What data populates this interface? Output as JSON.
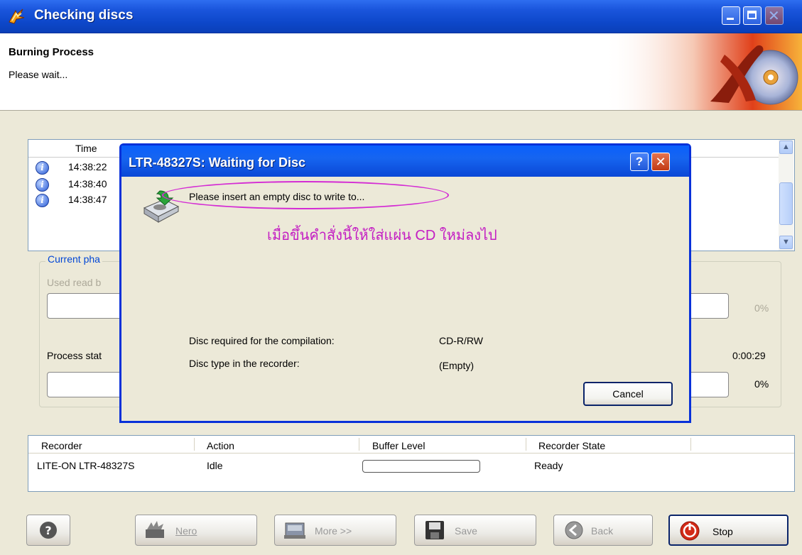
{
  "window": {
    "title": "Checking discs"
  },
  "header": {
    "title": "Burning Process",
    "subtitle": "Please wait..."
  },
  "log": {
    "column_time": "Time",
    "rows": [
      {
        "time": "14:38:22"
      },
      {
        "time": "14:38:40"
      },
      {
        "time": "14:38:47"
      }
    ]
  },
  "phase": {
    "legend": "Current pha",
    "buffer_label": "Used read b",
    "buffer_percent": "0%",
    "process_label": "Process stat",
    "elapsed": "0:00:29",
    "process_percent": "0%"
  },
  "recorder": {
    "headers": [
      "Recorder",
      "Action",
      "Buffer Level",
      "Recorder State"
    ],
    "row": {
      "name": "LITE-ON LTR-48327S",
      "action": "Idle",
      "state": "Ready"
    }
  },
  "buttons": {
    "nero": "Nero",
    "more": "More >>",
    "save": "Save",
    "back": "Back",
    "stop": "Stop"
  },
  "dialog": {
    "title": "LTR-48327S: Waiting for Disc",
    "help_glyph": "?",
    "close_glyph": "✕",
    "message": "Please insert an empty disc to write to...",
    "annotation": "เมื่อขึ้นคำสั่งนี้ให้ใส่แผ่น CD ใหม่ลงไป",
    "required_label": "Disc required for the compilation:",
    "required_value": "CD-R/RW",
    "type_label": "Disc type in the recorder:",
    "type_value": "(Empty)",
    "cancel": "Cancel"
  }
}
